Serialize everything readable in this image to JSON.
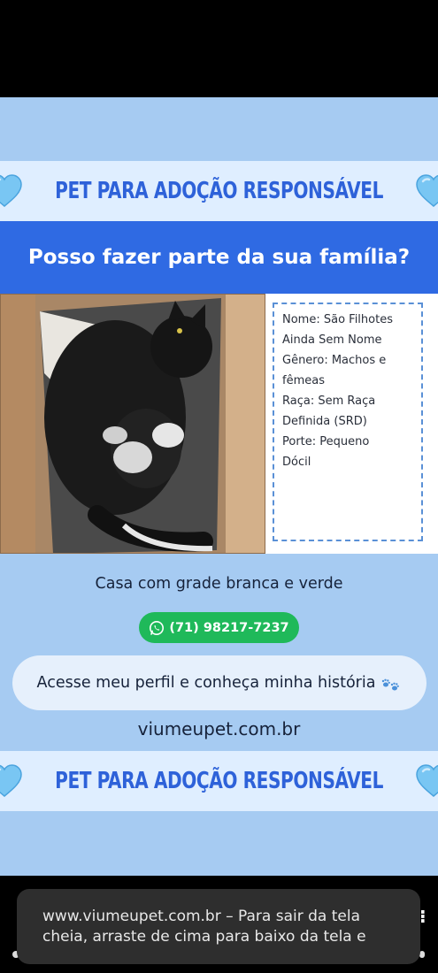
{
  "banner": {
    "text_top": "PET PARA ADOÇÃO RESPONSÁVEL",
    "text_bottom": "PET PARA ADOÇÃO RESPONSÁVEL",
    "icon": "light-blue-heart-icon"
  },
  "header": {
    "title": "Posso fazer parte da sua família?"
  },
  "photo": {
    "description_icon": "cat-with-kittens-photo"
  },
  "info": {
    "lines": [
      "Nome: São Filhotes",
      "Ainda Sem Nome",
      "Gênero: Machos e",
      "fêmeas",
      "Raça: Sem Raça",
      "Definida (SRD)",
      "Porte: Pequeno",
      "Dócil"
    ]
  },
  "contact": {
    "address": "Casa com grade branca e verde",
    "phone": "(71) 98217-7237",
    "profile_link": "Acesse meu perfil e conheça minha história",
    "website": "viumeupet.com.br"
  },
  "toast": {
    "message": "www.viumeupet.com.br – Para sair da tela cheia, arraste de cima para baixo da tela e"
  },
  "colors": {
    "poster_bg": "#a6cbf2",
    "banner_bg": "#dfeeff",
    "banner_text": "#2e62d9",
    "title_bar": "#2f6ae3",
    "whatsapp_green": "#1fb95a",
    "info_border": "#5a90d6"
  }
}
